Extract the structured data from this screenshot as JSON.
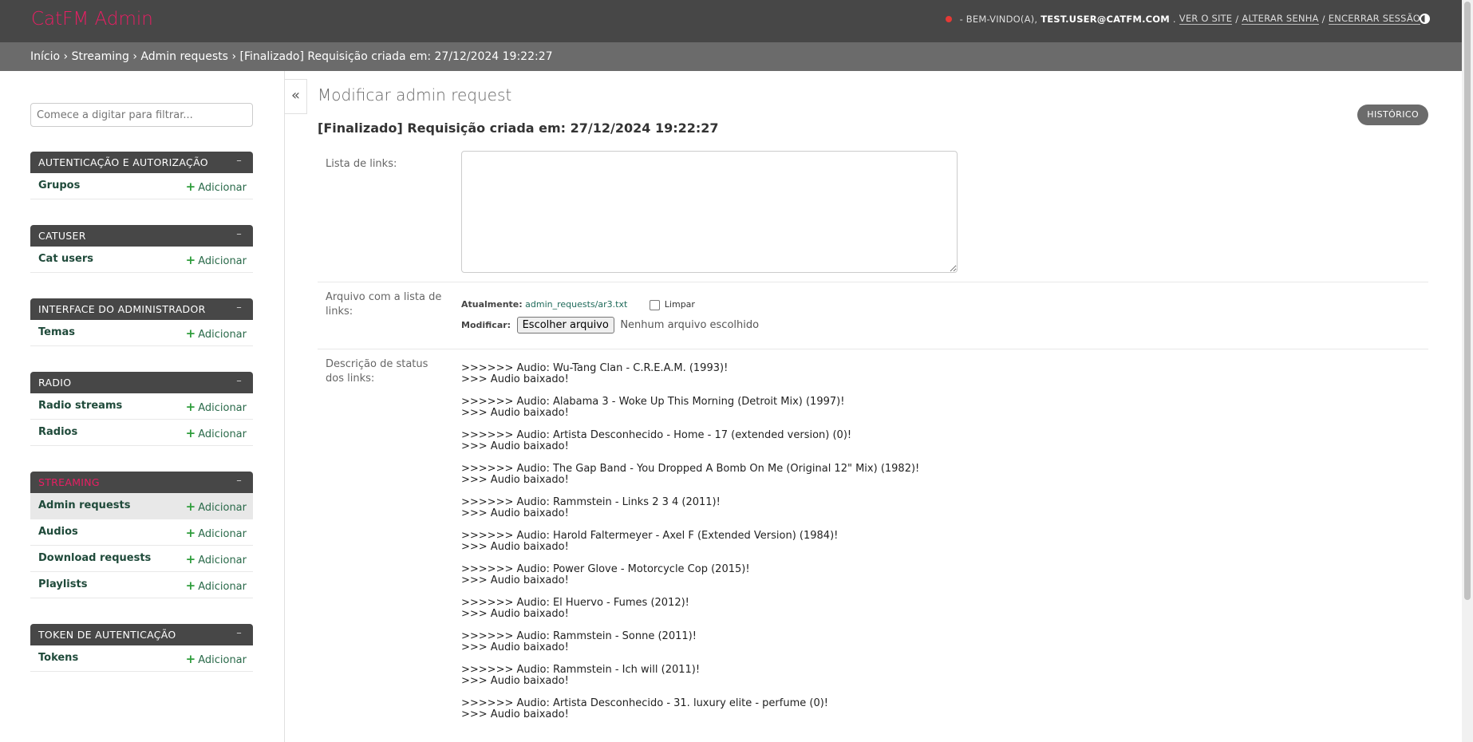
{
  "header": {
    "brand": "CatFM Admin",
    "welcome": "- Bem-vindo(a),",
    "user": "test.user@catfm.com",
    "view_site": "Ver o site",
    "change_password": "Alterar senha",
    "logout": "Encerrar sessão",
    "sep": "/"
  },
  "breadcrumbs": {
    "home": "Início",
    "app": "Streaming",
    "model": "Admin requests",
    "current": "[Finalizado] Requisição criada em: 27/12/2024 19:22:27",
    "sep": "›"
  },
  "sidebar": {
    "filter_placeholder": "Comece a digitar para filtrar...",
    "collapse_glyph": "–",
    "add_label": "Adicionar",
    "modules": [
      {
        "caption": "AUTENTICAÇÃO E AUTORIZAÇÃO",
        "models": [
          "Grupos"
        ]
      },
      {
        "caption": "CATUSER",
        "models": [
          "Cat users"
        ]
      },
      {
        "caption": "INTERFACE DO ADMINISTRADOR",
        "models": [
          "Temas"
        ]
      },
      {
        "caption": "RADIO",
        "models": [
          "Radio streams",
          "Radios"
        ]
      },
      {
        "caption": "STREAMING",
        "models": [
          "Admin requests",
          "Audios",
          "Download requests",
          "Playlists"
        ]
      },
      {
        "caption": "TOKEN DE AUTENTICAÇÃO",
        "models": [
          "Tokens"
        ]
      }
    ]
  },
  "toggle_nav": "«",
  "content": {
    "title": "Modificar admin request",
    "subtitle": "[Finalizado] Requisição criada em: 27/12/2024 19:22:27",
    "history": "HISTÓRICO",
    "links_label": "Lista de links:",
    "file_label": "Arquivo com a lista de links:",
    "currently_label": "Atualmente:",
    "current_file": "admin_requests/ar3.txt",
    "clear_label": "Limpar",
    "change_label": "Modificar:",
    "choose_file": "Escolher arquivo",
    "no_file": "Nenhum arquivo escolhido",
    "status_label": "Descrição de status dos links:",
    "status_entries": [
      {
        "audio": ">>>>>> Audio: Wu-Tang Clan - C.R.E.A.M. (1993)!",
        "result": ">>> Audio baixado!"
      },
      {
        "audio": ">>>>>> Audio: Alabama 3 - Woke Up This Morning (Detroit Mix) (1997)!",
        "result": ">>> Audio baixado!"
      },
      {
        "audio": ">>>>>> Audio: Artista Desconhecido - Home - 17 (extended version) (0)!",
        "result": ">>> Audio baixado!"
      },
      {
        "audio": ">>>>>> Audio: The Gap Band - You Dropped A Bomb On Me (Original 12\" Mix) (1982)!",
        "result": ">>> Audio baixado!"
      },
      {
        "audio": ">>>>>> Audio: Rammstein - Links 2 3 4 (2011)!",
        "result": ">>> Audio baixado!"
      },
      {
        "audio": ">>>>>> Audio: Harold Faltermeyer - Axel F (Extended Version) (1984)!",
        "result": ">>> Audio baixado!"
      },
      {
        "audio": ">>>>>> Audio: Power Glove - Motorcycle Cop (2015)!",
        "result": ">>> Audio baixado!"
      },
      {
        "audio": ">>>>>> Audio: El Huervo - Fumes (2012)!",
        "result": ">>> Audio baixado!"
      },
      {
        "audio": ">>>>>> Audio: Rammstein - Sonne (2011)!",
        "result": ">>> Audio baixado!"
      },
      {
        "audio": ">>>>>> Audio: Rammstein - Ich will (2011)!",
        "result": ">>> Audio baixado!"
      },
      {
        "audio": ">>>>>> Audio: Artista Desconhecido - 31. luxury elite - perfume (0)!",
        "result": ">>> Audio baixado!"
      }
    ]
  },
  "colors": {
    "brand": "#e91e63",
    "header": "#474747",
    "breadcrumbs": "#6b6b6b",
    "add": "#2e9d3b"
  }
}
